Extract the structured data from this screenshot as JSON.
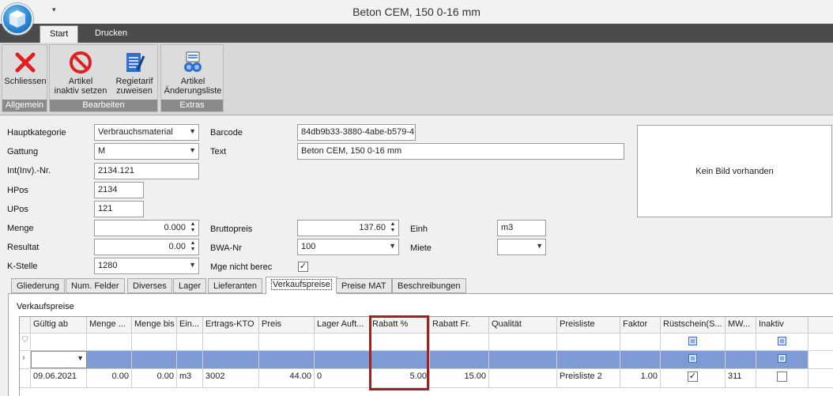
{
  "window": {
    "title": "Beton CEM, 150  0-16 mm"
  },
  "ribbon": {
    "tabs": [
      {
        "label": "Start"
      },
      {
        "label": "Drucken"
      }
    ],
    "groups": [
      {
        "label": "Allgemein",
        "buttons": [
          {
            "label": "Schliessen",
            "icon": "close-x-icon"
          }
        ]
      },
      {
        "label": "Bearbeiten",
        "buttons": [
          {
            "label_line1": "Artikel",
            "label_line2": "inaktiv setzen",
            "icon": "prohibit-icon"
          },
          {
            "label_line1": "Regietarif",
            "label_line2": "zuweisen",
            "icon": "notepad-icon"
          }
        ]
      },
      {
        "label": "Extras",
        "buttons": [
          {
            "label_line1": "Artikel",
            "label_line2": "Änderungsliste",
            "icon": "binoculars-icon"
          }
        ]
      }
    ]
  },
  "form": {
    "hauptkategorie": {
      "label": "Hauptkategorie",
      "value": "Verbrauchsmaterial"
    },
    "gattung": {
      "label": "Gattung",
      "value": "M"
    },
    "intnr": {
      "label": "Int(Inv).-Nr.",
      "value": "2134.121"
    },
    "hpos": {
      "label": "HPos",
      "value": "2134"
    },
    "upos": {
      "label": "UPos",
      "value": "121"
    },
    "menge": {
      "label": "Menge",
      "value": "0.000"
    },
    "resultat": {
      "label": "Resultat",
      "value": "0.00"
    },
    "kstelle": {
      "label": "K-Stelle",
      "value": "1280"
    },
    "barcode": {
      "label": "Barcode",
      "value": "84db9b33-3880-4abe-b579-4"
    },
    "text": {
      "label": "Text",
      "value": "Beton CEM, 150  0-16 mm"
    },
    "bruttopreis": {
      "label": "Bruttopreis",
      "value": "137.60"
    },
    "bwanr": {
      "label": "BWA-Nr",
      "value": "100"
    },
    "mge": {
      "label": "Mge nicht berec",
      "checked": true
    },
    "einh": {
      "label": "Einh",
      "value": "m3"
    },
    "miete": {
      "label": "Miete",
      "value": ""
    },
    "image_placeholder": "Kein Bild vorhanden"
  },
  "detail_tabs": [
    {
      "label": "Gliederung"
    },
    {
      "label": "Num. Felder"
    },
    {
      "label": "Diverses"
    },
    {
      "label": "Lager"
    },
    {
      "label": "Lieferanten"
    },
    {
      "label": "Verkaufspreise",
      "active": true
    },
    {
      "label": "Preise MAT"
    },
    {
      "label": "Beschreibungen"
    }
  ],
  "verkaufspreise": {
    "section_title": "Verkaufspreise",
    "columns": [
      "Gültig ab",
      "Menge ...",
      "Menge bis",
      "Ein...",
      "Ertrags-KTO",
      "Preis",
      "Lager Auft...",
      "Rabatt %",
      "Rabatt Fr.",
      "Qualität",
      "Preisliste",
      "Faktor",
      "Rüstschein(S...",
      "MW...",
      "Inaktiv"
    ],
    "rows": [
      {
        "gueltig_ab": "09.06.2021",
        "menge_von": "0.00",
        "menge_bis": "0.00",
        "einheit": "m3",
        "ertrags_kto": "3002",
        "preis": "44.00",
        "lager_auft": "0",
        "rabatt_pct": "5.00",
        "rabatt_fr": "15.00",
        "qualitaet": "",
        "preisliste": "Preisliste 2",
        "faktor": "1.00",
        "ruestschein": true,
        "mwst": "311",
        "inaktiv": false
      }
    ]
  }
}
